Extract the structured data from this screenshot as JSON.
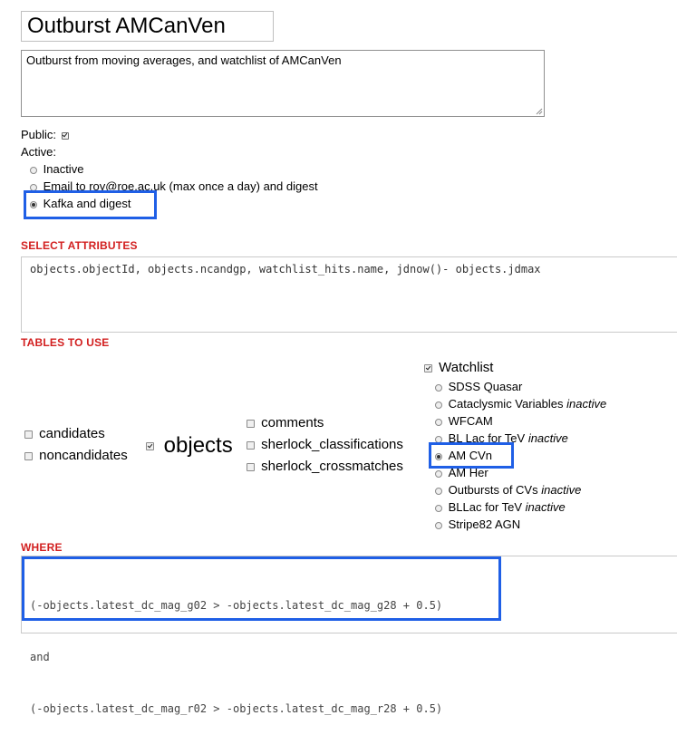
{
  "form": {
    "name": "Outburst AMCanVen",
    "description": "Outburst from moving averages, and watchlist of AMCanVen",
    "public_label": "Public:",
    "public_checked": true,
    "active_label": "Active:",
    "active_options": [
      {
        "label": "Inactive",
        "selected": false
      },
      {
        "label": "Email to roy@roe.ac.uk (max once a day) and digest",
        "selected": false
      },
      {
        "label": "Kafka and digest",
        "selected": true
      }
    ]
  },
  "select": {
    "heading": "SELECT ATTRIBUTES",
    "value": "objects.objectId, objects.ncandgp, watchlist_hits.name, jdnow()- objects.jdmax"
  },
  "tables": {
    "heading": "TABLES TO USE",
    "col1": [
      {
        "label": "candidates",
        "checked": false
      },
      {
        "label": "noncandidates",
        "checked": false
      }
    ],
    "col2": [
      {
        "label": "objects",
        "checked": true
      }
    ],
    "col3": [
      {
        "label": "comments",
        "checked": false
      },
      {
        "label": "sherlock_classifications",
        "checked": false
      },
      {
        "label": "sherlock_crossmatches",
        "checked": false
      }
    ],
    "watchlist": {
      "label": "Watchlist",
      "checked": true,
      "items": [
        {
          "label": "SDSS Quasar",
          "note": "",
          "selected": false
        },
        {
          "label": "Cataclysmic Variables",
          "note": "inactive",
          "selected": false
        },
        {
          "label": "WFCAM",
          "note": "",
          "selected": false
        },
        {
          "label": "BL Lac for TeV",
          "note": "inactive",
          "selected": false
        },
        {
          "label": "AM CVn",
          "note": "",
          "selected": true
        },
        {
          "label": "AM Her",
          "note": "",
          "selected": false
        },
        {
          "label": "Outbursts of CVs",
          "note": "inactive",
          "selected": false
        },
        {
          "label": "BLLac for TeV",
          "note": "inactive",
          "selected": false
        },
        {
          "label": "Stripe82 AGN",
          "note": "",
          "selected": false
        }
      ]
    }
  },
  "where": {
    "heading": "WHERE",
    "lines": [
      "(-objects.latest_dc_mag_g02 > -objects.latest_dc_mag_g28 + 0.5)",
      "and",
      "(-objects.latest_dc_mag_r02 > -objects.latest_dc_mag_r28 + 0.5)"
    ]
  },
  "colors": {
    "highlight": "#1f5fe6",
    "section_heading": "#d21f1f"
  }
}
